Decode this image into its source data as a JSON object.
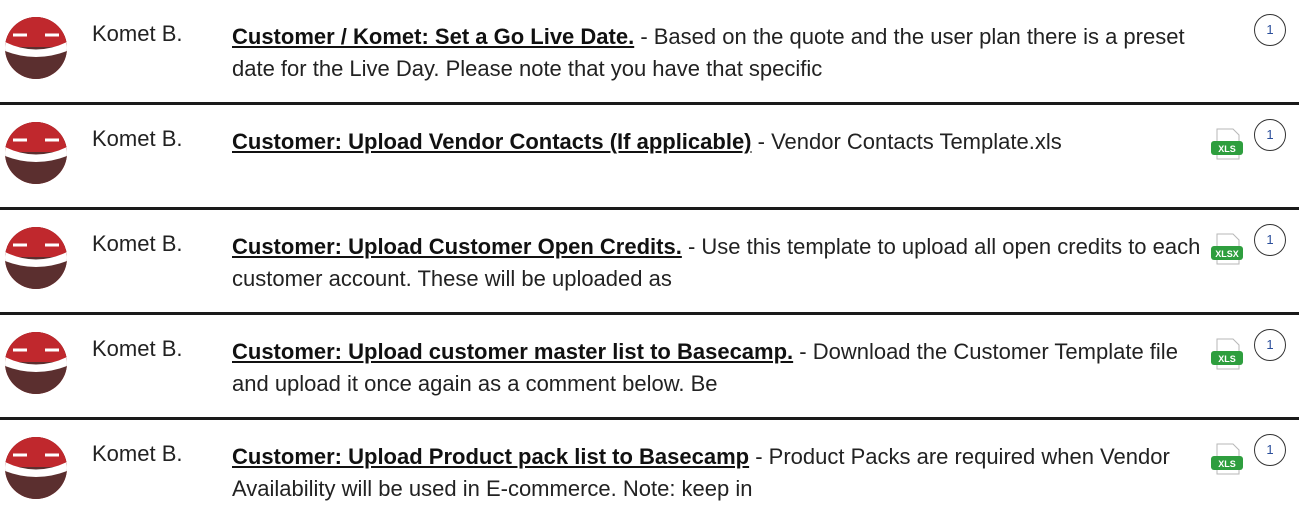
{
  "comments": [
    {
      "author": "Komet B.",
      "title": "Customer / Komet: Set a Go Live Date.",
      "excerpt": " - Based on the quote and the user plan there is a preset date for the Live Day. Please note that you have that specific",
      "attachment": "",
      "count": "1"
    },
    {
      "author": "Komet B.",
      "title": "Customer: Upload Vendor Contacts (If applicable)",
      "excerpt": " - Vendor Contacts Template.xls",
      "attachment": "XLS",
      "count": "1"
    },
    {
      "author": "Komet B.",
      "title": "Customer: Upload Customer Open Credits.",
      "excerpt": " - Use this template to upload all open credits to each customer account. These will be uploaded as",
      "attachment": "XLSX",
      "count": "1"
    },
    {
      "author": "Komet B.",
      "title": "Customer: Upload customer master list to Basecamp.",
      "excerpt": " - Download the Customer Template file and upload it once again as a comment below. Be",
      "attachment": "XLS",
      "count": "1"
    },
    {
      "author": "Komet B.",
      "title": "Customer: Upload Product pack list to Basecamp",
      "excerpt": " - Product Packs are required when Vendor Availability will be used in E-commerce. Note: keep in",
      "attachment": "XLS",
      "count": "1"
    }
  ],
  "colors": {
    "avatar_red": "#c0282d",
    "avatar_dark": "#5b2f2f",
    "file_green": "#2e9e3e",
    "badge_text": "#2a4e9a"
  }
}
